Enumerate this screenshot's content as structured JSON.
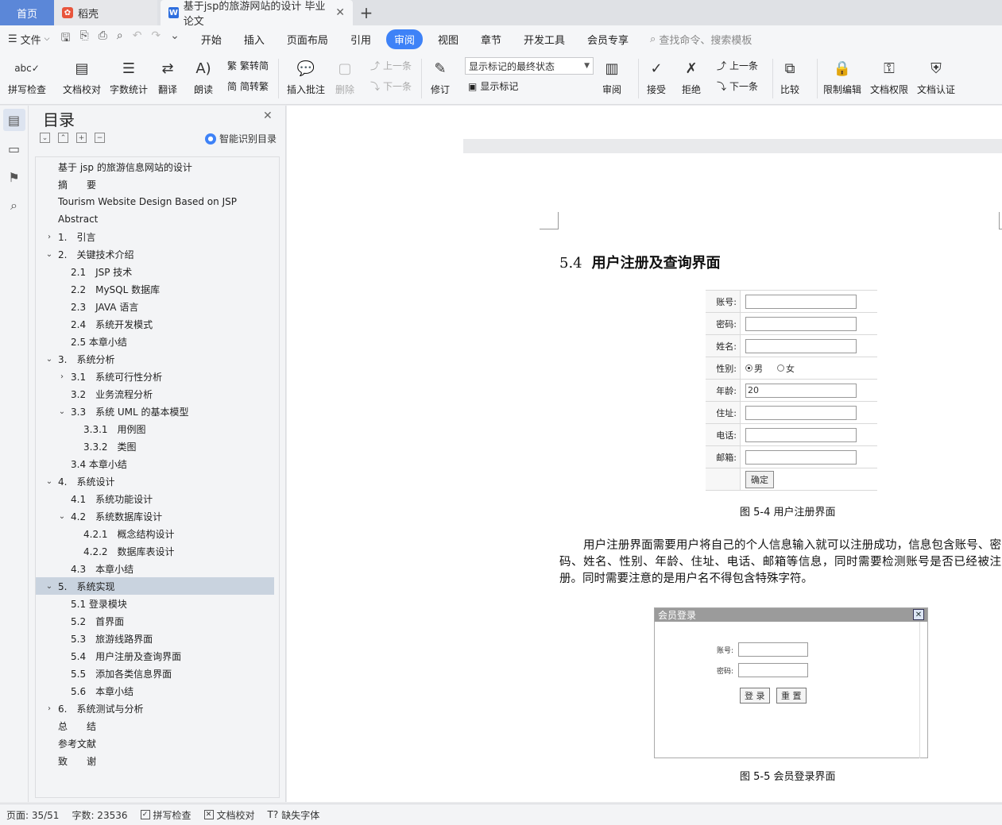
{
  "tabs": {
    "home": "首页",
    "daoke": "稻壳",
    "doc": "基于jsp的旅游网站的设计 毕业论文"
  },
  "menu": {
    "file": "文件",
    "items": [
      "开始",
      "插入",
      "页面布局",
      "引用",
      "审阅",
      "视图",
      "章节",
      "开发工具",
      "会员专享"
    ],
    "active": "审阅",
    "search_placeholder": "查找命令、搜索模板"
  },
  "ribbon": {
    "spell_check": "拼写检查",
    "doc_proof": "文档校对",
    "word_count": "字数统计",
    "translate": "翻译",
    "read_aloud": "朗读",
    "trad_to_simp": "繁转简",
    "simp_to_trad": "简转繁",
    "insert_comment": "插入批注",
    "delete": "删除",
    "prev": "上一条",
    "next": "下一条",
    "revise": "修订",
    "markup_state": "显示标记的最终状态",
    "show_markup": "显示标记",
    "review": "审阅",
    "accept": "接受",
    "reject": "拒绝",
    "prev2": "上一条",
    "next2": "下一条",
    "compare": "比较",
    "restrict_edit": "限制编辑",
    "doc_permission": "文档权限",
    "doc_cert": "文档认证"
  },
  "toc": {
    "title": "目录",
    "smart": "智能识别目录",
    "items": [
      {
        "text": "基于 jsp 的旅游信息网站的设计",
        "level": 0,
        "chev": ""
      },
      {
        "text": "摘　　要",
        "level": 0,
        "chev": ""
      },
      {
        "text": "Tourism Website Design Based on JSP",
        "level": 0,
        "chev": ""
      },
      {
        "text": "Abstract",
        "level": 0,
        "chev": ""
      },
      {
        "text": "1.　引言",
        "level": 0,
        "chev": ">"
      },
      {
        "text": "2.　关键技术介绍",
        "level": 0,
        "chev": "v"
      },
      {
        "text": "2.1　JSP 技术",
        "level": 1,
        "chev": ""
      },
      {
        "text": "2.2　MySQL 数据库",
        "level": 1,
        "chev": ""
      },
      {
        "text": "2.3　JAVA 语言",
        "level": 1,
        "chev": ""
      },
      {
        "text": "2.4　系统开发模式",
        "level": 1,
        "chev": ""
      },
      {
        "text": "2.5 本章小结",
        "level": 1,
        "chev": ""
      },
      {
        "text": "3.　系统分析",
        "level": 0,
        "chev": "v"
      },
      {
        "text": "3.1　系统可行性分析",
        "level": 1,
        "chev": ">"
      },
      {
        "text": "3.2　业务流程分析",
        "level": 1,
        "chev": ""
      },
      {
        "text": "3.3　系统 UML 的基本模型",
        "level": 1,
        "chev": "v"
      },
      {
        "text": "3.3.1　用例图",
        "level": 2,
        "chev": ""
      },
      {
        "text": "3.3.2　类图",
        "level": 2,
        "chev": ""
      },
      {
        "text": "3.4 本章小结",
        "level": 1,
        "chev": ""
      },
      {
        "text": "4.　系统设计",
        "level": 0,
        "chev": "v"
      },
      {
        "text": "4.1　系统功能设计",
        "level": 1,
        "chev": ""
      },
      {
        "text": "4.2　系统数据库设计",
        "level": 1,
        "chev": "v"
      },
      {
        "text": "4.2.1　概念结构设计",
        "level": 2,
        "chev": ""
      },
      {
        "text": "4.2.2　数据库表设计",
        "level": 2,
        "chev": ""
      },
      {
        "text": "4.3　本章小结",
        "level": 1,
        "chev": ""
      },
      {
        "text": "5.　系统实现",
        "level": 0,
        "chev": "v",
        "selected": true
      },
      {
        "text": "5.1 登录模块",
        "level": 1,
        "chev": ""
      },
      {
        "text": "5.2　首界面",
        "level": 1,
        "chev": ""
      },
      {
        "text": "5.3　旅游线路界面",
        "level": 1,
        "chev": ""
      },
      {
        "text": "5.4　用户注册及查询界面",
        "level": 1,
        "chev": ""
      },
      {
        "text": "5.5　添加各类信息界面",
        "level": 1,
        "chev": ""
      },
      {
        "text": "5.6　本章小结",
        "level": 1,
        "chev": ""
      },
      {
        "text": "6.　系统测试与分析",
        "level": 0,
        "chev": ">"
      },
      {
        "text": "总　　结",
        "level": 0,
        "chev": ""
      },
      {
        "text": "参考文献",
        "level": 0,
        "chev": ""
      },
      {
        "text": "致　　谢",
        "level": 0,
        "chev": ""
      }
    ]
  },
  "doc": {
    "heading_num": "5.4",
    "heading_text": "用户注册及查询界面",
    "regform": {
      "rows": [
        {
          "label": "账号:",
          "type": "input",
          "value": ""
        },
        {
          "label": "密码:",
          "type": "input",
          "value": ""
        },
        {
          "label": "姓名:",
          "type": "input",
          "value": ""
        },
        {
          "label": "性别:",
          "type": "radio",
          "options": [
            "男",
            "女"
          ],
          "selected": "男"
        },
        {
          "label": "年龄:",
          "type": "input",
          "value": "20"
        },
        {
          "label": "住址:",
          "type": "input",
          "value": ""
        },
        {
          "label": "电话:",
          "type": "input",
          "value": ""
        },
        {
          "label": "邮箱:",
          "type": "input",
          "value": ""
        }
      ],
      "submit": "确定"
    },
    "caption1": "图 5-4 用户注册界面",
    "para1": "用户注册界面需要用户将自己的个人信息输入就可以注册成功，信息包含账号、密码、姓名、性别、年龄、住址、电话、邮箱等信息，同时需要检测账号是否已经被注册。同时需要注意的是用户名不得包含特殊字符。",
    "login": {
      "title": "会员登录",
      "account_label": "账号:",
      "password_label": "密码:",
      "login_btn": "登 录",
      "reset_btn": "重 置"
    },
    "caption2": "图 5-5 会员登录界面"
  },
  "status": {
    "page": "页面: 35/51",
    "words": "字数: 23536",
    "spell": "拼写检查",
    "proof": "文档校对",
    "missing_font": "缺失字体"
  }
}
